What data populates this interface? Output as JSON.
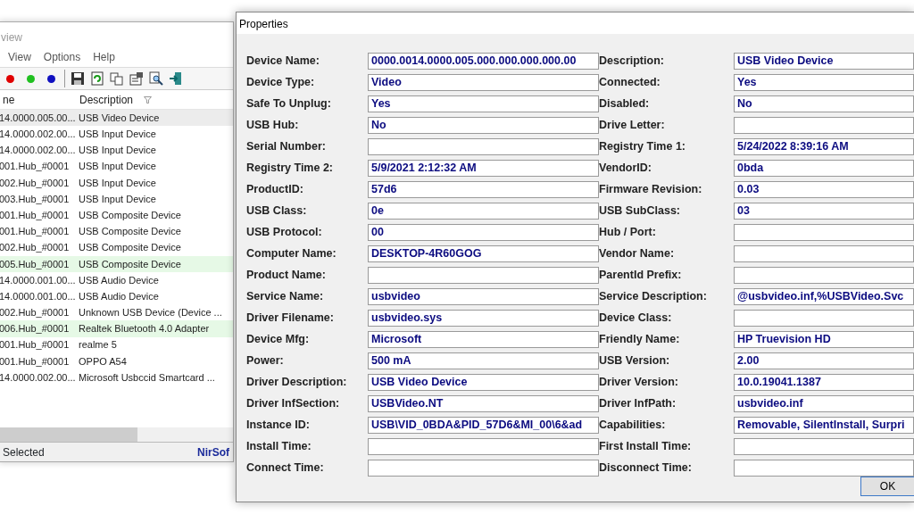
{
  "main_window": {
    "title": "view",
    "menu": [
      "View",
      "Options",
      "Help"
    ],
    "columns": [
      "ne",
      "Description"
    ],
    "rows": [
      {
        "name": "14.0000.005.00...",
        "description": "USB Video Device",
        "selected": true,
        "connected": false
      },
      {
        "name": "14.0000.002.00...",
        "description": "USB Input Device",
        "selected": false,
        "connected": false
      },
      {
        "name": "14.0000.002.00...",
        "description": "USB Input Device",
        "selected": false,
        "connected": false
      },
      {
        "name": "001.Hub_#0001",
        "description": "USB Input Device",
        "selected": false,
        "connected": false
      },
      {
        "name": "002.Hub_#0001",
        "description": "USB Input Device",
        "selected": false,
        "connected": false
      },
      {
        "name": "003.Hub_#0001",
        "description": "USB Input Device",
        "selected": false,
        "connected": false
      },
      {
        "name": "001.Hub_#0001",
        "description": "USB Composite Device",
        "selected": false,
        "connected": false
      },
      {
        "name": "001.Hub_#0001",
        "description": "USB Composite Device",
        "selected": false,
        "connected": false
      },
      {
        "name": "002.Hub_#0001",
        "description": "USB Composite Device",
        "selected": false,
        "connected": false
      },
      {
        "name": "005.Hub_#0001",
        "description": "USB Composite Device",
        "selected": false,
        "connected": true
      },
      {
        "name": "14.0000.001.00...",
        "description": "USB Audio Device",
        "selected": false,
        "connected": false
      },
      {
        "name": "14.0000.001.00...",
        "description": "USB Audio Device",
        "selected": false,
        "connected": false
      },
      {
        "name": "002.Hub_#0001",
        "description": "Unknown USB Device (Device ...",
        "selected": false,
        "connected": false
      },
      {
        "name": "006.Hub_#0001",
        "description": "Realtek Bluetooth 4.0 Adapter",
        "selected": false,
        "connected": true
      },
      {
        "name": "001.Hub_#0001",
        "description": "realme 5",
        "selected": false,
        "connected": false
      },
      {
        "name": "001.Hub_#0001",
        "description": "OPPO A54",
        "selected": false,
        "connected": false
      },
      {
        "name": "14.0000.002.00...",
        "description": "Microsoft Usbccid Smartcard ...",
        "selected": false,
        "connected": false
      }
    ],
    "status_bar": {
      "selection": "Selected",
      "credit": "NirSof"
    }
  },
  "properties": {
    "title": "Properties",
    "fields": [
      {
        "label": "Device Name:",
        "value": "0000.0014.0000.005.000.000.000.000.00"
      },
      {
        "label": "Description:",
        "value": "USB Video Device"
      },
      {
        "label": "Device Type:",
        "value": "Video"
      },
      {
        "label": "Connected:",
        "value": "Yes"
      },
      {
        "label": "Safe To Unplug:",
        "value": "Yes"
      },
      {
        "label": "Disabled:",
        "value": "No"
      },
      {
        "label": "USB Hub:",
        "value": "No"
      },
      {
        "label": "Drive Letter:"
      },
      {
        "label": "Serial Number:"
      },
      {
        "label": "Registry Time 1:",
        "value": "5/24/2022 8:39:16 AM"
      },
      {
        "label": "Registry Time 2:",
        "value": "5/9/2021 2:12:32 AM"
      },
      {
        "label": "VendorID:",
        "value": "0bda"
      },
      {
        "label": "ProductID:",
        "value": "57d6"
      },
      {
        "label": "Firmware Revision:",
        "value": "0.03"
      },
      {
        "label": "USB Class:",
        "value": "0e"
      },
      {
        "label": "USB SubClass:",
        "value": "03"
      },
      {
        "label": "USB Protocol:",
        "value": "00"
      },
      {
        "label": "Hub / Port:"
      },
      {
        "label": "Computer Name:",
        "value": "DESKTOP-4R60GOG"
      },
      {
        "label": "Vendor Name:"
      },
      {
        "label": "Product Name:"
      },
      {
        "label": "ParentId Prefix:"
      },
      {
        "label": "Service Name:",
        "value": "usbvideo"
      },
      {
        "label": "Service Description:",
        "value": "@usbvideo.inf,%USBVideo.Svc"
      },
      {
        "label": "Driver Filename:",
        "value": "usbvideo.sys"
      },
      {
        "label": "Device Class:"
      },
      {
        "label": "Device Mfg:",
        "value": "Microsoft"
      },
      {
        "label": "Friendly Name:",
        "value": "HP Truevision HD"
      },
      {
        "label": "Power:",
        "value": "500 mA"
      },
      {
        "label": "USB Version:",
        "value": "2.00"
      },
      {
        "label": "Driver Description:",
        "value": "USB Video Device"
      },
      {
        "label": "Driver Version:",
        "value": "10.0.19041.1387"
      },
      {
        "label": "Driver InfSection:",
        "value": "USBVideo.NT"
      },
      {
        "label": "Driver InfPath:",
        "value": "usbvideo.inf"
      },
      {
        "label": "Instance ID:",
        "value": "USB\\VID_0BDA&PID_57D6&MI_00\\6&ad"
      },
      {
        "label": "Capabilities:",
        "value": "Removable, SilentInstall, Surpri"
      },
      {
        "label": "Install Time:"
      },
      {
        "label": "First Install Time:"
      },
      {
        "label": "Connect Time:"
      },
      {
        "label": "Disconnect Time:"
      }
    ],
    "ok_button": "OK"
  }
}
